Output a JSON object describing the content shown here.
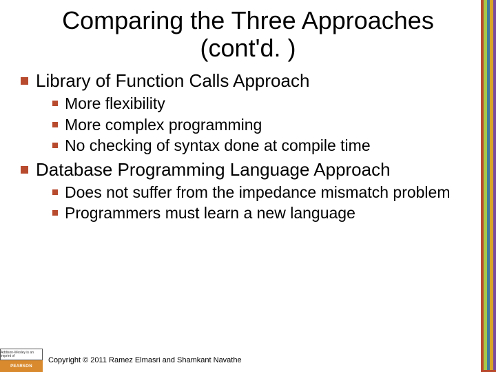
{
  "title": "Comparing the Three Approaches (cont'd. )",
  "points": [
    {
      "text": "Library of Function Calls Approach",
      "subs": [
        "More flexibility",
        "More complex programming",
        "No checking of syntax done at compile time"
      ]
    },
    {
      "text": "Database Programming Language Approach",
      "subs": [
        "Does not suffer from the impedance mismatch problem",
        "Programmers must learn a new language"
      ]
    }
  ],
  "footer": {
    "imprint": "Addison-Wesley is an imprint of",
    "brand": "PEARSON",
    "copyright": "Copyright © 2011 Ramez Elmasri and Shamkant Navathe"
  }
}
